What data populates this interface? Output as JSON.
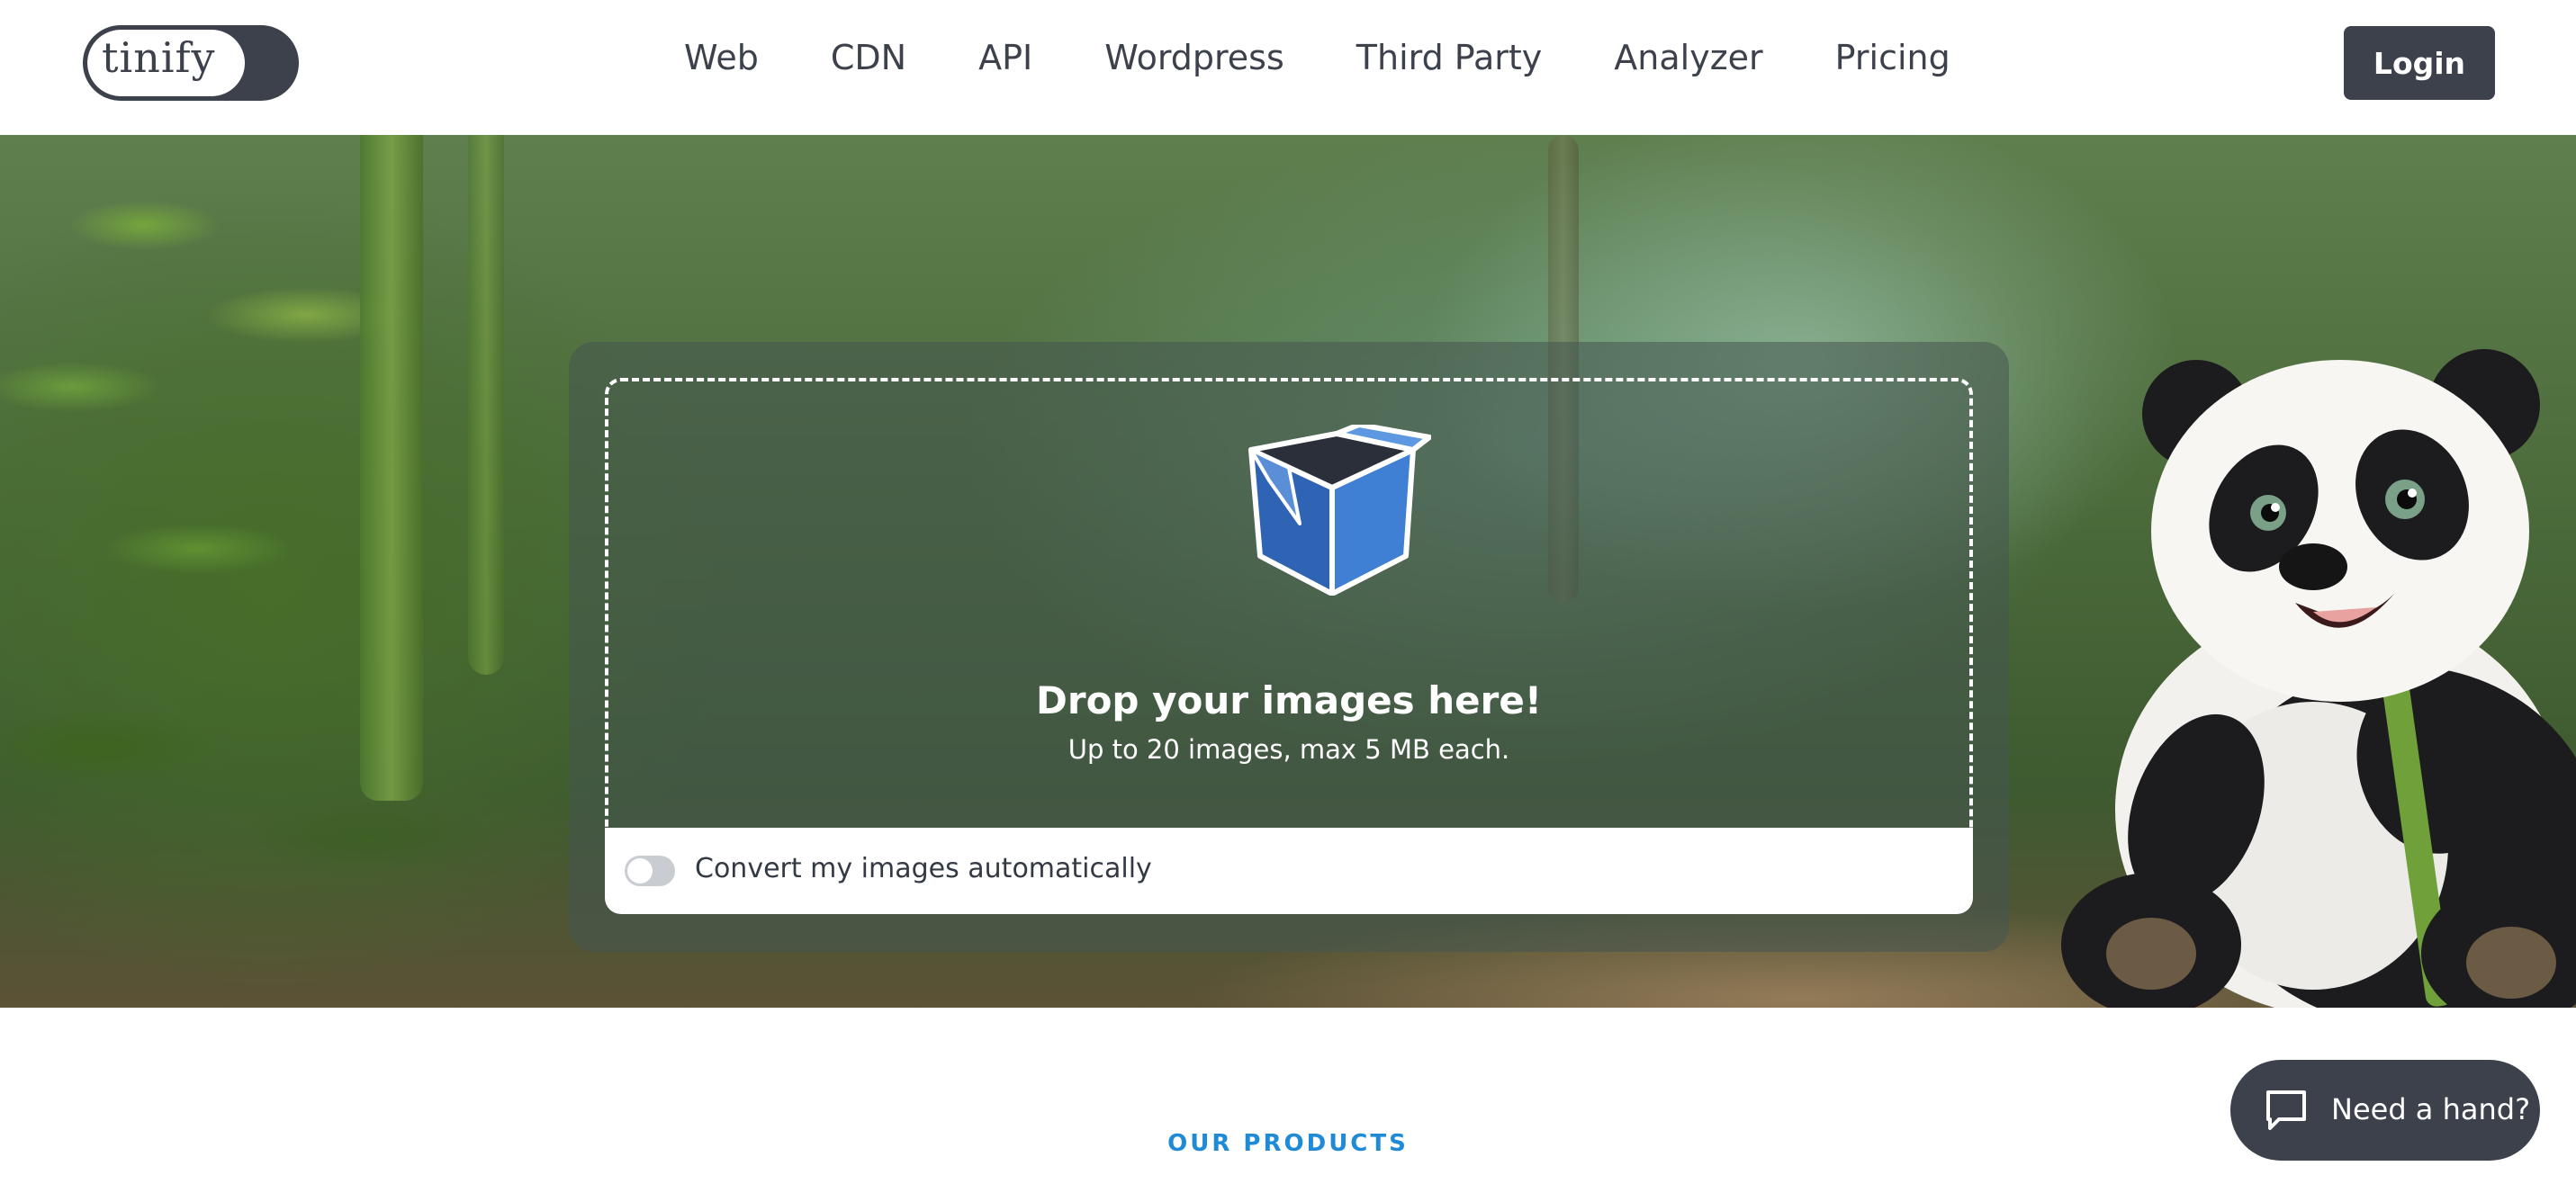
{
  "brand": {
    "logo_text": "tinify"
  },
  "nav": {
    "items": [
      "Web",
      "CDN",
      "API",
      "Wordpress",
      "Third Party",
      "Analyzer",
      "Pricing"
    ],
    "login_label": "Login"
  },
  "upload": {
    "title": "Drop your images here!",
    "subtitle": "Up to 20 images, max 5 MB each.",
    "convert_label": "Convert my images automatically",
    "convert_enabled": false
  },
  "sections": {
    "products_label": "OUR PRODUCTS"
  },
  "help": {
    "label": "Need a hand?"
  },
  "colors": {
    "dark": "#3c414c",
    "accent_blue": "#1f8ad6",
    "box_blue": "#3b74c8"
  },
  "icons": [
    "box-icon",
    "chat-icon",
    "toggle-switch"
  ]
}
